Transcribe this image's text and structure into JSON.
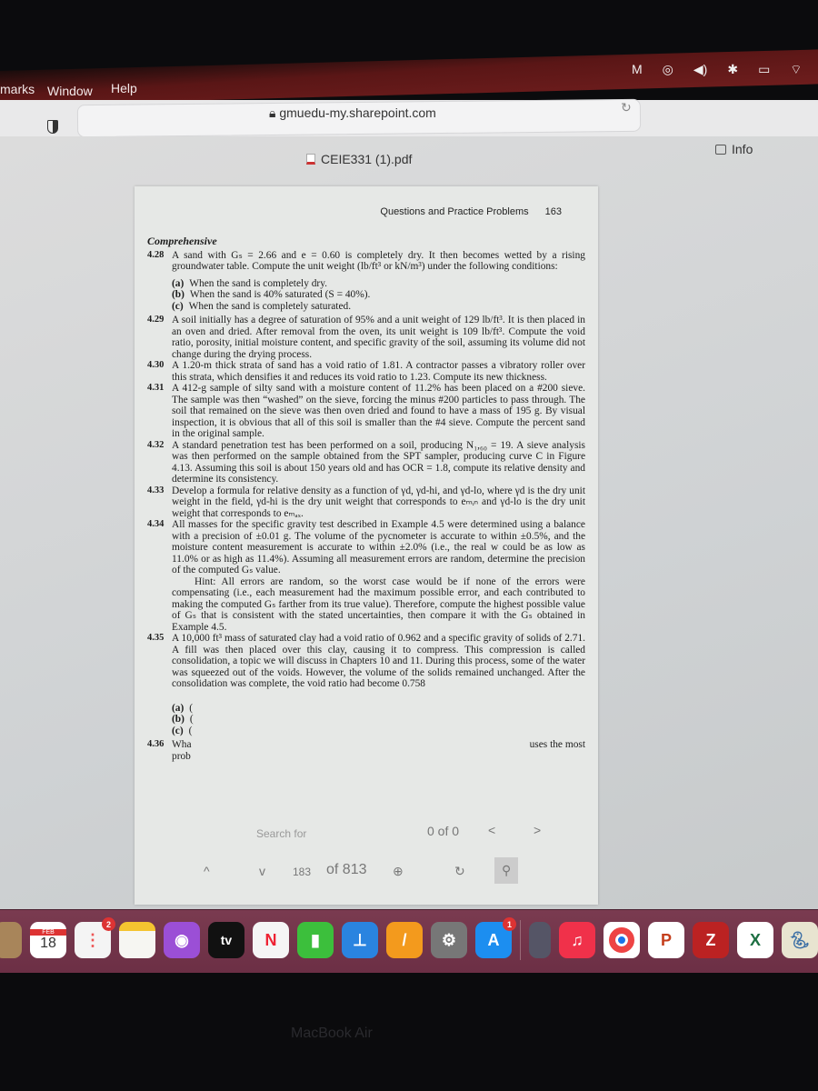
{
  "menubar": {
    "items": [
      "marks",
      "Window",
      "Help"
    ],
    "status_icons": [
      "malwarebytes-icon",
      "airdrop-icon",
      "volume-icon",
      "bluetooth-icon",
      "battery-icon",
      "wifi-icon"
    ]
  },
  "browser": {
    "url": "gmuedu-my.sharepoint.com",
    "file_name": "CEIE331 (1).pdf",
    "info_label": "Info"
  },
  "page": {
    "running_head": "Questions and Practice Problems",
    "page_number": "163",
    "section": "Comprehensive",
    "problems": [
      {
        "num": "4.28",
        "text": "A sand with Gₛ = 2.66 and e = 0.60 is completely dry. It then becomes wetted by a rising groundwater table. Compute the unit weight (lb/ft³ or kN/m³) under the following conditions:",
        "parts": [
          {
            "label": "(a)",
            "text": "When the sand is completely dry."
          },
          {
            "label": "(b)",
            "text": "When the sand is 40% saturated (S = 40%)."
          },
          {
            "label": "(c)",
            "text": "When the sand is completely saturated."
          }
        ]
      },
      {
        "num": "4.29",
        "text": "A soil initially has a degree of saturation of 95% and a unit weight of 129 lb/ft³. It is then placed in an oven and dried. After removal from the oven, its unit weight is 109 lb/ft³. Compute the void ratio, porosity, initial moisture content, and specific gravity of the soil, assuming its volume did not change during the drying process."
      },
      {
        "num": "4.30",
        "text": "A 1.20-m thick strata of sand has a void ratio of 1.81. A contractor passes a vibratory roller over this strata, which densifies it and reduces its void ratio to 1.23. Compute its new thickness."
      },
      {
        "num": "4.31",
        "text": "A 412-g sample of silty sand with a moisture content of 11.2% has been placed on a #200 sieve. The sample was then “washed” on the sieve, forcing the minus #200 particles to pass through. The soil that remained on the sieve was then oven dried and found to have a mass of 195 g. By visual inspection, it is obvious that all of this soil is smaller than the #4 sieve. Compute the percent sand in the original sample."
      },
      {
        "num": "4.32",
        "text": "A standard penetration test has been performed on a soil, producing N₁,₆₀ = 19. A sieve analysis was then performed on the sample obtained from the SPT sampler, producing curve C in Figure 4.13. Assuming this soil is about 150 years old and has OCR = 1.8, compute its relative density and determine its consistency."
      },
      {
        "num": "4.33",
        "text": "Develop a formula for relative density as a function of γd, γd-hi, and γd-lo, where γd is the dry unit weight in the field, γd-hi is the dry unit weight that corresponds to eₘᵢₙ and γd-lo is the dry unit weight that corresponds to eₘₐₓ."
      },
      {
        "num": "4.34",
        "text": "All masses for the specific gravity test described in Example 4.5 were determined using a balance with a precision of ±0.01 g. The volume of the pycnometer is accurate to within ±0.5%, and the moisture content measurement is accurate to within ±2.0% (i.e., the real w could be as low as 11.0% or as high as 11.4%). Assuming all measurement errors are random, determine the precision of the computed Gₛ value.",
        "hint": "Hint: All errors are random, so the worst case would be if none of the errors were compensating (i.e., each measurement had the maximum possible error, and each contributed to making the computed Gₛ farther from its true value). Therefore, compute the highest possible value of Gₛ that is consistent with the stated uncertainties, then compare it with the Gₛ obtained in Example 4.5."
      },
      {
        "num": "4.35",
        "text": "A 10,000 ft³ mass of saturated clay had a void ratio of 0.962 and a specific gravity of solids of 2.71. A fill was then placed over this clay, causing it to compress. This compression is called consolidation, a topic we will discuss in Chapters 10 and 11. During this process, some of the water was squeezed out of the voids. However, the volume of the solids remained unchanged. After the consolidation was complete, the void ratio had become 0.758",
        "parts": [
          {
            "label": "(a)",
            "text": "("
          },
          {
            "label": "(b)",
            "text": "("
          },
          {
            "label": "(c)",
            "text": "("
          }
        ]
      },
      {
        "num": "4.36",
        "text": "Wha",
        "tail": "uses the most",
        "line2": "prob"
      }
    ]
  },
  "find_bar": {
    "placeholder": "Search for",
    "count": "0 of 0",
    "prev": "<",
    "next": ">",
    "up": "^",
    "down": "v",
    "current_page": "183",
    "total_pages": "of 813"
  },
  "dock": {
    "apps": [
      {
        "name": "finder"
      },
      {
        "name": "calendar",
        "month": "FEB",
        "day": "18"
      },
      {
        "name": "reminders",
        "badge": "2"
      },
      {
        "name": "notes"
      },
      {
        "name": "podcasts"
      },
      {
        "name": "apple-tv",
        "label": "tv"
      },
      {
        "name": "news"
      },
      {
        "name": "numbers"
      },
      {
        "name": "keynote"
      },
      {
        "name": "pages"
      },
      {
        "name": "system-preferences"
      },
      {
        "name": "app-store",
        "badge": "1"
      },
      {
        "name": "python-launcher"
      },
      {
        "name": "music"
      },
      {
        "name": "chrome"
      },
      {
        "name": "powerpoint",
        "label": "P"
      },
      {
        "name": "zotero",
        "label": "Z"
      },
      {
        "name": "excel",
        "label": "X"
      },
      {
        "name": "python"
      }
    ]
  },
  "bezel_label": "MacBook Air"
}
